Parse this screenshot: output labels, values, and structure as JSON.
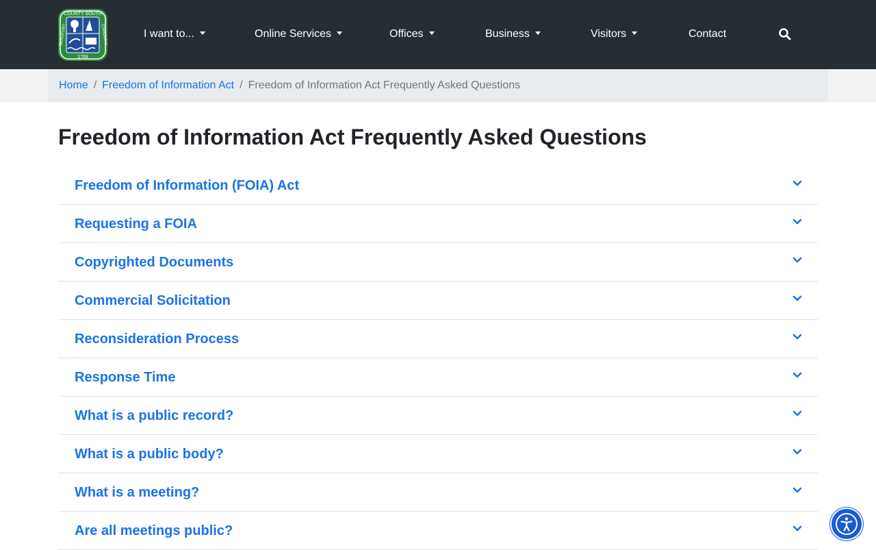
{
  "header": {
    "logo": {
      "top_text": "COUNTY SOUTH",
      "left_text": "BEAUFORT",
      "right_text": "CAROLINA",
      "year": "1769",
      "colors": {
        "ring": "#2e8b3e",
        "inner": "#1f4f9a"
      }
    },
    "nav": [
      {
        "label": "I want to...",
        "dropdown": true
      },
      {
        "label": "Online Services",
        "dropdown": true
      },
      {
        "label": "Offices",
        "dropdown": true
      },
      {
        "label": "Business",
        "dropdown": true
      },
      {
        "label": "Visitors",
        "dropdown": true
      },
      {
        "label": "Contact",
        "dropdown": false
      }
    ],
    "search_icon": "search-icon"
  },
  "breadcrumb": {
    "items": [
      "Home",
      "Freedom of Information Act"
    ],
    "separator": "/",
    "current": "Freedom of Information Act Frequently Asked Questions"
  },
  "page": {
    "title": "Freedom of Information Act Frequently Asked Questions"
  },
  "accordion": {
    "items": [
      {
        "label": "Freedom of Information (FOIA) Act"
      },
      {
        "label": "Requesting a FOIA"
      },
      {
        "label": "Copyrighted Documents"
      },
      {
        "label": "Commercial Solicitation"
      },
      {
        "label": "Reconsideration Process"
      },
      {
        "label": "Response Time"
      },
      {
        "label": "What is a public record?"
      },
      {
        "label": "What is a public body?"
      },
      {
        "label": "What is a meeting?"
      },
      {
        "label": "Are all meetings public?"
      }
    ]
  },
  "accessibility_button": {
    "icon": "accessibility-icon"
  },
  "colors": {
    "navbar": "#262d33",
    "link": "#1a73e8",
    "breadcrumb_bg": "#e9ecef",
    "muted": "#6c757d",
    "a11y": "#1a5bd6"
  }
}
